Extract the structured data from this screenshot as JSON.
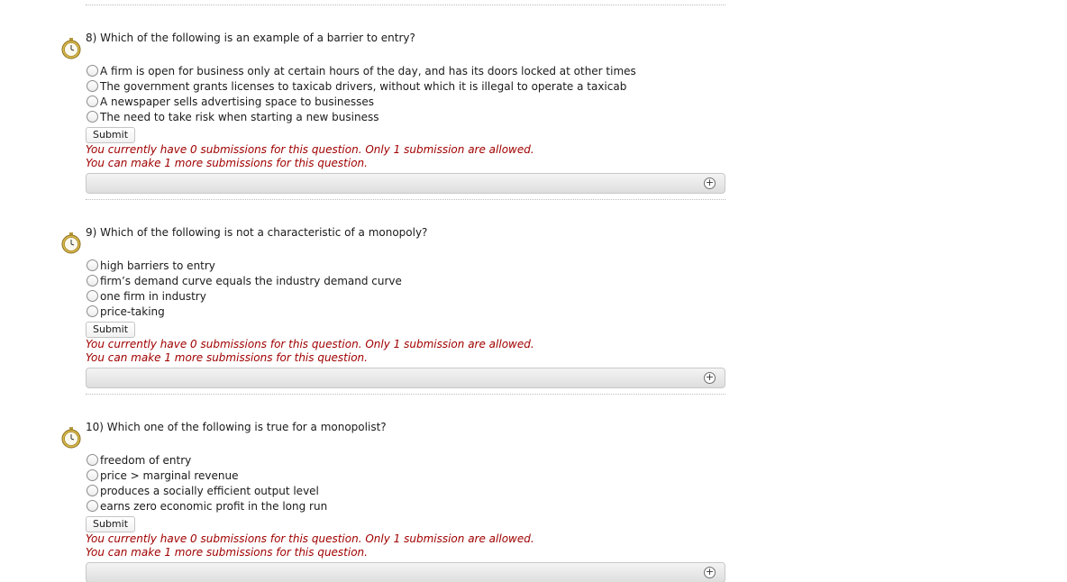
{
  "submit_label": "Submit",
  "status_line_1": "You currently have 0 submissions for this question. Only 1 submission are allowed.",
  "status_line_2": "You can make 1 more submissions for this question.",
  "colors": {
    "status_text": "#a00000",
    "divider": "#bdbdbd"
  },
  "icons": {
    "timer": "stopwatch-icon",
    "expand": "plus-circle-icon"
  },
  "questions": [
    {
      "text": "8) Which of the following is an example of a barrier to entry?",
      "options": [
        "A firm is open for business only at certain hours of the day, and has its doors locked at other times",
        "The government grants licenses to taxicab drivers, without which it is illegal to operate a taxicab",
        "A newspaper sells advertising space to businesses",
        "The need to take risk when starting a new business"
      ]
    },
    {
      "text": "9) Which of the following is not a characteristic of a monopoly?",
      "options": [
        "high barriers to entry",
        "firm’s demand curve equals the industry demand curve",
        "one firm in industry",
        "price-taking"
      ]
    },
    {
      "text": "10) Which one of the following is true for a monopolist?",
      "options": [
        "freedom of entry",
        "price > marginal revenue",
        "produces a socially efficient output level",
        "earns zero economic profit in the long run"
      ]
    }
  ]
}
